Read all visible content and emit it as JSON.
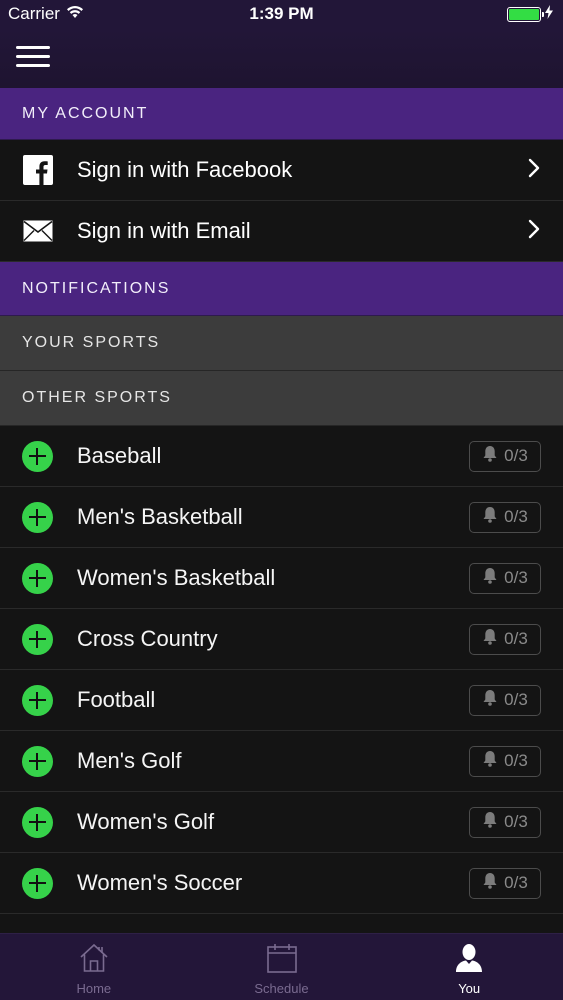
{
  "status_bar": {
    "carrier": "Carrier",
    "time": "1:39 PM",
    "battery_level": 1.0
  },
  "sections": {
    "my_account": "MY ACCOUNT",
    "notifications": "NOTIFICATIONS",
    "your_sports": "YOUR SPORTS",
    "other_sports": "OTHER SPORTS"
  },
  "account": {
    "facebook_label": "Sign in with Facebook",
    "email_label": "Sign in with Email"
  },
  "sports": [
    {
      "name": "Baseball",
      "notifications": "0/3"
    },
    {
      "name": "Men's Basketball",
      "notifications": "0/3"
    },
    {
      "name": "Women's Basketball",
      "notifications": "0/3"
    },
    {
      "name": "Cross Country",
      "notifications": "0/3"
    },
    {
      "name": "Football",
      "notifications": "0/3"
    },
    {
      "name": "Men's Golf",
      "notifications": "0/3"
    },
    {
      "name": "Women's Golf",
      "notifications": "0/3"
    },
    {
      "name": "Women's Soccer",
      "notifications": "0/3"
    }
  ],
  "tabs": [
    {
      "label": "Home",
      "icon": "house-icon",
      "active": false
    },
    {
      "label": "Schedule",
      "icon": "calendar-icon",
      "active": false
    },
    {
      "label": "You",
      "icon": "person-icon",
      "active": true
    }
  ],
  "colors": {
    "accent_purple": "#4a2480",
    "add_green": "#36d24a",
    "tab_bar": "#231639"
  }
}
